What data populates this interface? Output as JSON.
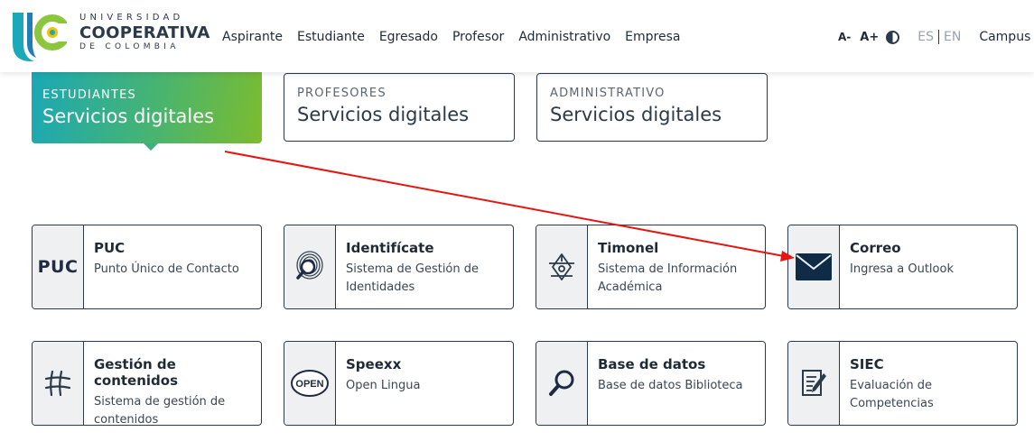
{
  "header": {
    "logo": {
      "line1": "UNIVERSIDAD",
      "line2": "COOPERATIVA",
      "line3": "DE COLOMBIA"
    },
    "nav": [
      "Aspirante",
      "Estudiante",
      "Egresado",
      "Profesor",
      "Administrativo",
      "Empresa"
    ],
    "font_decrease": "A-",
    "font_increase": "A+",
    "lang_es": "ES",
    "lang_en": "EN",
    "campus": "Campus"
  },
  "categories": [
    {
      "kicker": "ESTUDIANTES",
      "title": "Servicios digitales"
    },
    {
      "kicker": "PROFESORES",
      "title": "Servicios digitales"
    },
    {
      "kicker": "ADMINISTRATIVO",
      "title": "Servicios digitales"
    }
  ],
  "services": [
    {
      "title": "PUC",
      "desc": "Punto Único de Contacto",
      "icon": "puc-icon"
    },
    {
      "title": "Identifícate",
      "desc": "Sistema de Gestión de Identidades",
      "icon": "fingerprint-icon"
    },
    {
      "title": "Timonel",
      "desc": "Sistema de Información Académica",
      "icon": "timonel-icon"
    },
    {
      "title": "Correo",
      "desc": "Ingresa a Outlook",
      "icon": "mail-icon"
    },
    {
      "title": "Gestión de contenidos",
      "desc": "Sistema de gestión de contenidos",
      "icon": "moodle-icon"
    },
    {
      "title": "Speexx",
      "desc": "Open Lingua",
      "icon": "open-icon"
    },
    {
      "title": "Base de datos",
      "desc": "Base de datos Biblioteca",
      "icon": "magnifier-icon"
    },
    {
      "title": "SIEC",
      "desc": "Evaluación de Competencias",
      "icon": "evaluation-icon"
    }
  ],
  "colors": {
    "accent_start": "#1aa8b6",
    "accent_end": "#7cbc2f",
    "dark": "#2b3a4a",
    "annotation_arrow": "#e8140f"
  },
  "icon_labels": {
    "puc": "PUC",
    "open": "OPEN"
  }
}
